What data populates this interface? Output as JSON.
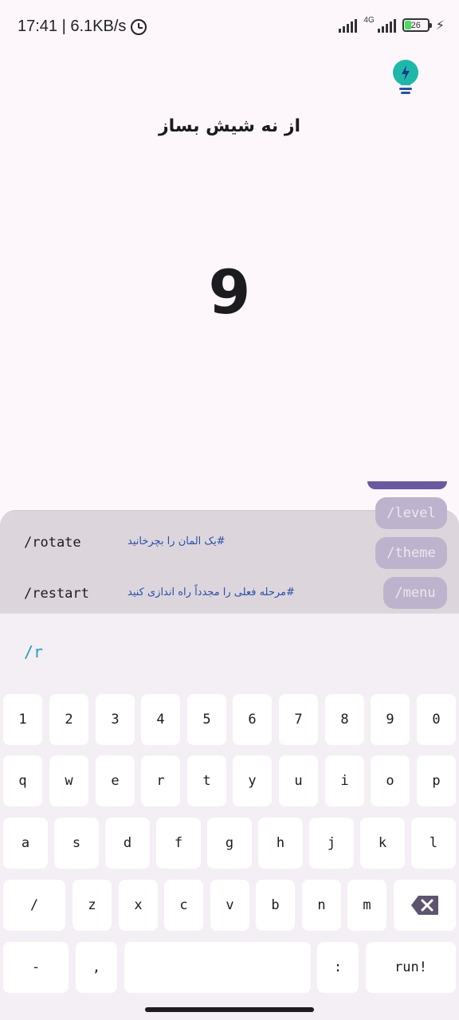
{
  "status_bar": {
    "time_speed": "17:41 | 6.1KB/s",
    "network_type": "4G",
    "battery_level": "26"
  },
  "icons": {
    "hint": "lightbulb-icon",
    "alarm": "alarm-icon",
    "signal": "signal-icon",
    "battery": "battery-icon",
    "charging": "charging-bolt-icon",
    "backspace": "backspace-icon"
  },
  "header": {
    "title": "از نه شیش بساز"
  },
  "puzzle": {
    "number": "9"
  },
  "suggestions": [
    {
      "command": "/rotate",
      "description": "#یک المان را بچرخانید"
    },
    {
      "command": "/restart",
      "description": "#مرحله فعلی را مجدداً راه اندازی کنید"
    }
  ],
  "quick_commands": {
    "level": "/level",
    "theme": "/theme",
    "menu": "/menu"
  },
  "input": {
    "value": "/r"
  },
  "keyboard": {
    "row1": [
      "1",
      "2",
      "3",
      "4",
      "5",
      "6",
      "7",
      "8",
      "9",
      "0"
    ],
    "row2": [
      "q",
      "w",
      "e",
      "r",
      "t",
      "y",
      "u",
      "i",
      "o",
      "p"
    ],
    "row3": [
      "a",
      "s",
      "d",
      "f",
      "g",
      "h",
      "j",
      "k",
      "l"
    ],
    "row4": [
      "/",
      "z",
      "x",
      "c",
      "v",
      "b",
      "n",
      "m"
    ],
    "row5": {
      "dash": "-",
      "comma": ",",
      "space": "",
      "colon": ":",
      "run": "run!"
    }
  },
  "colors": {
    "background": "#fdf7fc",
    "accent_teal": "#1fb8a8",
    "suggestion_text": "#2b4fa8",
    "pill": "#bdb3cd",
    "pill_top": "#6c58a0"
  }
}
